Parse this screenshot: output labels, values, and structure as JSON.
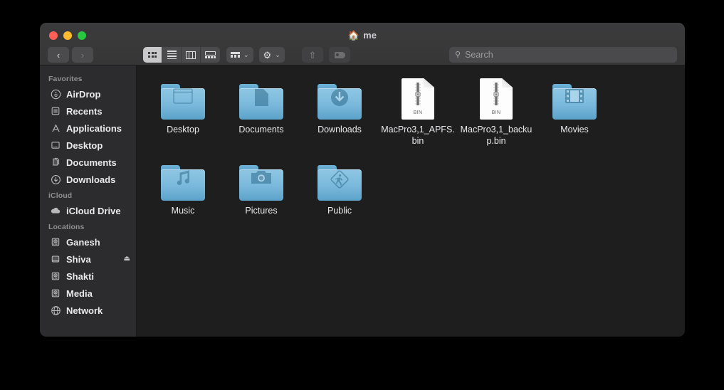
{
  "window": {
    "title": "me",
    "title_icon": "home-icon",
    "traffic_lights": {
      "close_color": "#ff5f57",
      "minimize_color": "#febc2e",
      "maximize_color": "#28c840"
    }
  },
  "toolbar": {
    "back_label": "‹",
    "forward_label": "›",
    "view_modes": [
      {
        "name": "icon-view",
        "active": true
      },
      {
        "name": "list-view",
        "active": false
      },
      {
        "name": "column-view",
        "active": false
      },
      {
        "name": "gallery-view",
        "active": false
      }
    ],
    "group_caret": "⌄",
    "action_gear": "⚙",
    "action_caret": "⌄",
    "share_glyph": "⇧",
    "search": {
      "placeholder": "Search",
      "value": "",
      "icon": "search-icon"
    }
  },
  "sidebar": {
    "sections": [
      {
        "header": "Favorites",
        "items": [
          {
            "label": "AirDrop",
            "icon": "airdrop-icon"
          },
          {
            "label": "Recents",
            "icon": "recents-icon"
          },
          {
            "label": "Applications",
            "icon": "applications-icon"
          },
          {
            "label": "Desktop",
            "icon": "desktop-icon"
          },
          {
            "label": "Documents",
            "icon": "documents-icon"
          },
          {
            "label": "Downloads",
            "icon": "downloads-icon"
          }
        ]
      },
      {
        "header": "iCloud",
        "items": [
          {
            "label": "iCloud Drive",
            "icon": "cloud-icon"
          }
        ]
      },
      {
        "header": "Locations",
        "items": [
          {
            "label": "Ganesh",
            "icon": "internal-drive-icon",
            "eject": ""
          },
          {
            "label": "Shiva",
            "icon": "external-drive-icon",
            "eject": "⏏"
          },
          {
            "label": "Shakti",
            "icon": "internal-drive-icon",
            "eject": ""
          },
          {
            "label": "Media",
            "icon": "internal-drive-icon",
            "eject": ""
          },
          {
            "label": "Network",
            "icon": "network-icon",
            "eject": ""
          }
        ]
      }
    ]
  },
  "content": {
    "items": [
      {
        "name": "Desktop",
        "kind": "folder",
        "emblem": "window-emblem"
      },
      {
        "name": "Documents",
        "kind": "folder",
        "emblem": "page-emblem"
      },
      {
        "name": "Downloads",
        "kind": "folder",
        "emblem": "download-arrow-emblem"
      },
      {
        "name": "MacPro3,1_APFS.bin",
        "kind": "bin-document",
        "badge": "BIN"
      },
      {
        "name": "MacPro3,1_backup.bin",
        "kind": "bin-document",
        "badge": "BIN"
      },
      {
        "name": "Movies",
        "kind": "folder",
        "emblem": "filmstrip-emblem"
      },
      {
        "name": "Music",
        "kind": "folder",
        "emblem": "music-note-emblem"
      },
      {
        "name": "Pictures",
        "kind": "folder",
        "emblem": "camera-emblem"
      },
      {
        "name": "Public",
        "kind": "folder",
        "emblem": "walking-person-emblem"
      }
    ]
  },
  "colors": {
    "desktop_background": "#000000",
    "titlebar": "#393939",
    "sidebar": "#2c2c2e",
    "content_background": "#1e1e1f",
    "folder_blue": "#79b8db",
    "text_primary": "#eaeaec",
    "text_secondary": "#8e8e93"
  }
}
